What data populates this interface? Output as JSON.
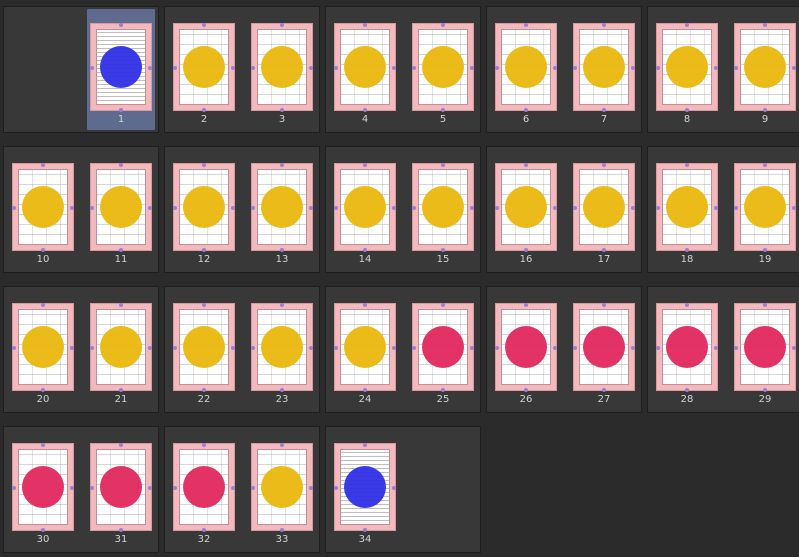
{
  "colors": {
    "yellow": "#e9b70d",
    "blue": "#2f2fe6",
    "red": "#e2285e"
  },
  "spreads": [
    [
      null,
      {
        "number": "1",
        "marker": "blue",
        "selected": true,
        "style": "doc"
      }
    ],
    [
      {
        "number": "2",
        "marker": "yellow"
      },
      {
        "number": "3",
        "marker": "yellow"
      }
    ],
    [
      {
        "number": "4",
        "marker": "yellow"
      },
      {
        "number": "5",
        "marker": "yellow"
      }
    ],
    [
      {
        "number": "6",
        "marker": "yellow"
      },
      {
        "number": "7",
        "marker": "yellow"
      }
    ],
    [
      {
        "number": "8",
        "marker": "yellow"
      },
      {
        "number": "9",
        "marker": "yellow"
      }
    ],
    [
      {
        "number": "10",
        "marker": "yellow"
      },
      {
        "number": "11",
        "marker": "yellow"
      }
    ],
    [
      {
        "number": "12",
        "marker": "yellow"
      },
      {
        "number": "13",
        "marker": "yellow"
      }
    ],
    [
      {
        "number": "14",
        "marker": "yellow"
      },
      {
        "number": "15",
        "marker": "yellow"
      }
    ],
    [
      {
        "number": "16",
        "marker": "yellow"
      },
      {
        "number": "17",
        "marker": "yellow"
      }
    ],
    [
      {
        "number": "18",
        "marker": "yellow"
      },
      {
        "number": "19",
        "marker": "yellow"
      }
    ],
    [
      {
        "number": "20",
        "marker": "yellow"
      },
      {
        "number": "21",
        "marker": "yellow"
      }
    ],
    [
      {
        "number": "22",
        "marker": "yellow"
      },
      {
        "number": "23",
        "marker": "yellow"
      }
    ],
    [
      {
        "number": "24",
        "marker": "yellow"
      },
      {
        "number": "25",
        "marker": "red"
      }
    ],
    [
      {
        "number": "26",
        "marker": "red"
      },
      {
        "number": "27",
        "marker": "red"
      }
    ],
    [
      {
        "number": "28",
        "marker": "red"
      },
      {
        "number": "29",
        "marker": "red"
      }
    ],
    [
      {
        "number": "30",
        "marker": "red"
      },
      {
        "number": "31",
        "marker": "red"
      }
    ],
    [
      {
        "number": "32",
        "marker": "red"
      },
      {
        "number": "33",
        "marker": "yellow"
      }
    ],
    [
      {
        "number": "34",
        "marker": "blue",
        "style": "doc"
      },
      null
    ]
  ]
}
